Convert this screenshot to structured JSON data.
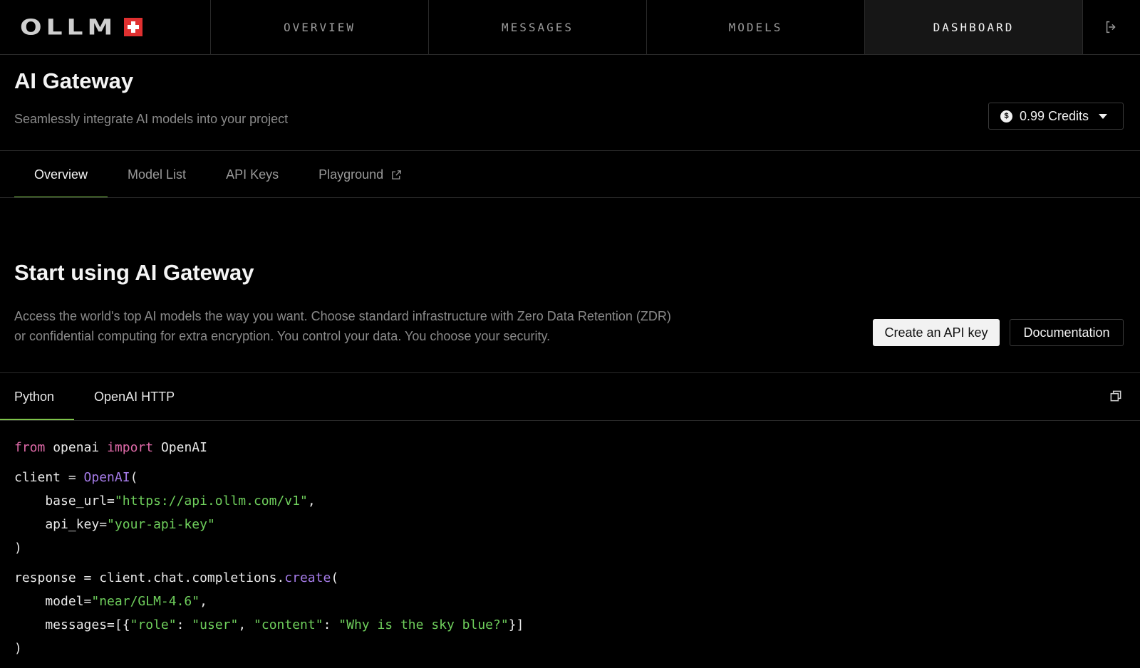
{
  "app": {
    "logo_text": "OLLM"
  },
  "nav": {
    "items": [
      {
        "label": "OVERVIEW",
        "active": false
      },
      {
        "label": "MESSAGES",
        "active": false
      },
      {
        "label": "MODELS",
        "active": false
      },
      {
        "label": "DASHBOARD",
        "active": true
      }
    ],
    "logout_icon": "logout-icon"
  },
  "header": {
    "title": "AI Gateway",
    "subtitle": "Seamlessly integrate AI models into your project",
    "credits_label": "0.99 Credits",
    "credits_icon": "dollar-coin-icon"
  },
  "tabs": [
    {
      "label": "Overview",
      "active": true
    },
    {
      "label": "Model List",
      "active": false
    },
    {
      "label": "API Keys",
      "active": false
    },
    {
      "label": "Playground",
      "active": false,
      "icon": "external-link-icon"
    }
  ],
  "start": {
    "title": "Start using AI Gateway",
    "description": "Access the world's top AI models the way you want. Choose standard infrastructure with Zero Data Retention (ZDR) or confidential computing for extra encryption. You control your data. You choose your security.",
    "primary_button": "Create an API key",
    "secondary_button": "Documentation"
  },
  "code_tabs": [
    {
      "label": "Python",
      "active": true
    },
    {
      "label": "OpenAI HTTP",
      "active": false
    }
  ],
  "code": {
    "copy_icon": "copy-icon",
    "lines": [
      "from openai import OpenAI",
      "client = OpenAI(",
      "    base_url=\"https://api.ollm.com/v1\",",
      "    api_key=\"your-api-key\"",
      ")",
      "response = client.chat.completions.create(",
      "    model=\"near/GLM-4.6\",",
      "    messages=[{\"role\": \"user\", \"content\": \"Why is the sky blue?\"}]",
      ")"
    ],
    "tokens": {
      "from": "from",
      "import": "import",
      "openai": "openai",
      "OpenAI": "OpenAI",
      "client": "client",
      "base_url": "https://api.ollm.com/v1",
      "api_key": "your-api-key",
      "create": "create",
      "model": "near/GLM-4.6",
      "role_key": "role",
      "role_val": "user",
      "content_key": "content",
      "content_val": "Why is the sky blue?"
    }
  },
  "colors": {
    "background": "#000000",
    "accent_underline": "#7ec34a",
    "keyword": "#e06aa9",
    "function": "#a57be8",
    "string": "#6fcf5c",
    "flag_red": "#e03030"
  }
}
